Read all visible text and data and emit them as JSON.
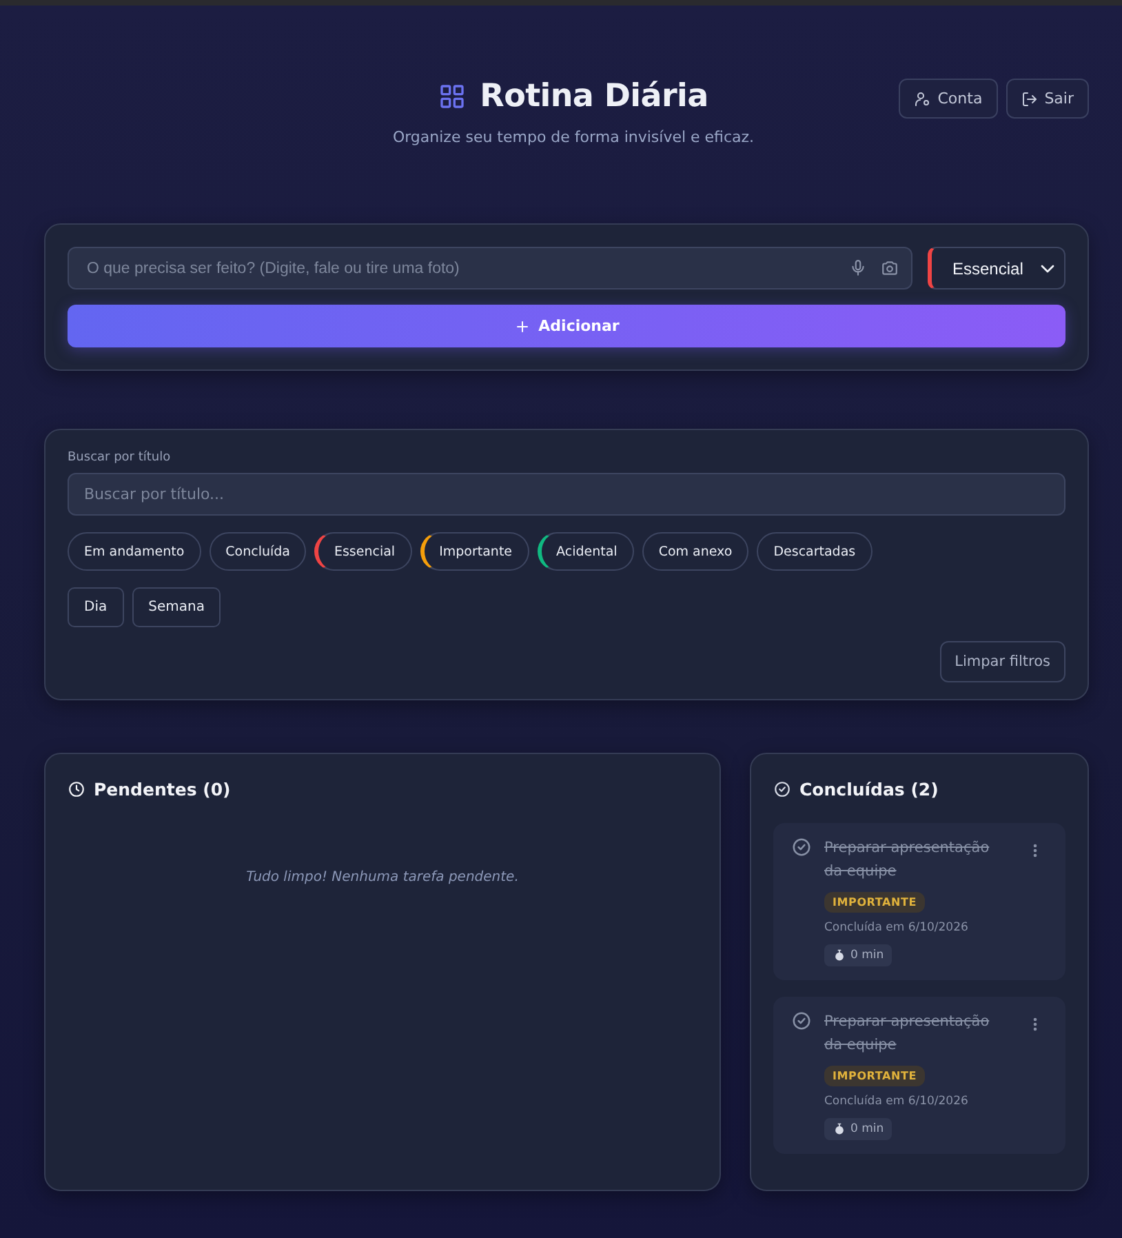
{
  "header": {
    "title": "Rotina Diária",
    "subtitle": "Organize seu tempo de forma invisível e eficaz.",
    "buttons": [
      {
        "label": "Conta",
        "kind": "account"
      },
      {
        "label": "Sair",
        "kind": "logout"
      }
    ]
  },
  "composer": {
    "placeholder": "O que precisa ser feito? (Digite, fale ou tire uma foto)",
    "priority": {
      "value": "Essencial",
      "color": "#ef4444"
    },
    "add_button": "Adicionar"
  },
  "filters": {
    "search_label": "Buscar por título",
    "search_placeholder": "Buscar por título...",
    "chips": [
      {
        "label": "Em andamento"
      },
      {
        "label": "Concluída"
      },
      {
        "label": "Essencial",
        "color": "#ef4444"
      },
      {
        "label": "Importante",
        "color": "#f59e0b"
      },
      {
        "label": "Acidental",
        "color": "#10b981"
      },
      {
        "label": "Com anexo"
      },
      {
        "label": "Descartadas"
      }
    ],
    "periods": [
      {
        "label": "Dia"
      },
      {
        "label": "Semana"
      }
    ],
    "clear_button": "Limpar filtros"
  },
  "pending": {
    "title": "Pendentes (0)",
    "empty_text": "Tudo limpo! Nenhuma tarefa pendente."
  },
  "done": {
    "title": "Concluídas (2)",
    "tasks": [
      {
        "title": "Preparar apresentação da equipe",
        "tag": "IMPORTANTE",
        "completed_text": "Concluída em 6/10/2026",
        "duration": "0 min"
      },
      {
        "title": "Preparar apresentação da equipe",
        "tag": "IMPORTANTE",
        "completed_text": "Concluída em 6/10/2026",
        "duration": "0 min"
      }
    ]
  }
}
